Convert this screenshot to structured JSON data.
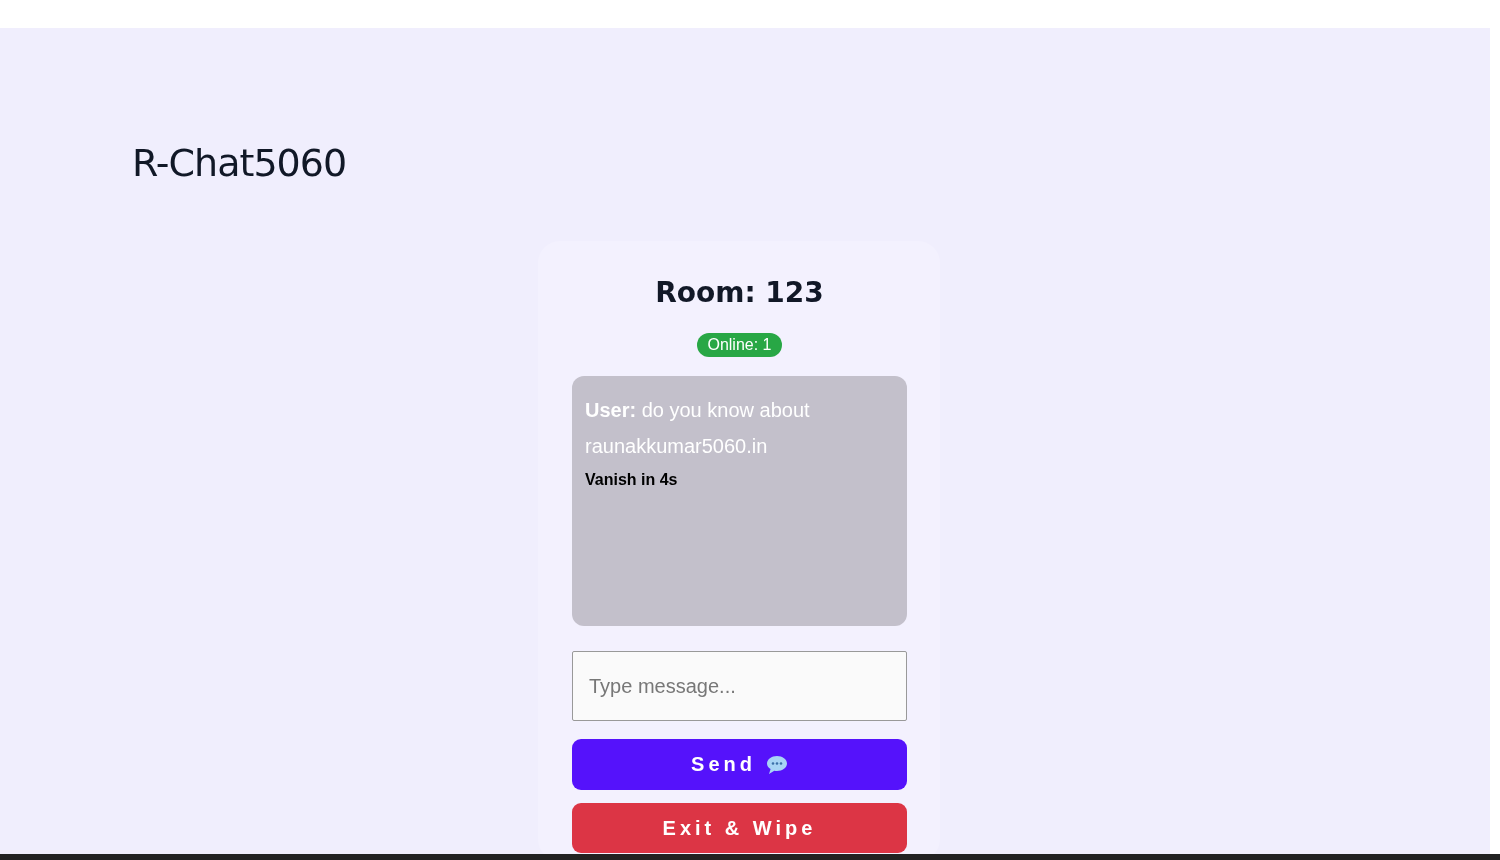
{
  "app": {
    "title": "R-Chat5060"
  },
  "room": {
    "title": "Room: 123",
    "online": "Online: 1"
  },
  "messages": [
    {
      "text": "**User:** do you know about raunakkumar5060.in",
      "timer": "Vanish in 4s"
    }
  ],
  "composer": {
    "placeholder": "Type message..."
  },
  "buttons": [
    {
      "kind": "send",
      "label": "Send"
    },
    {
      "kind": "exit",
      "label": "Exit & Wipe"
    }
  ]
}
